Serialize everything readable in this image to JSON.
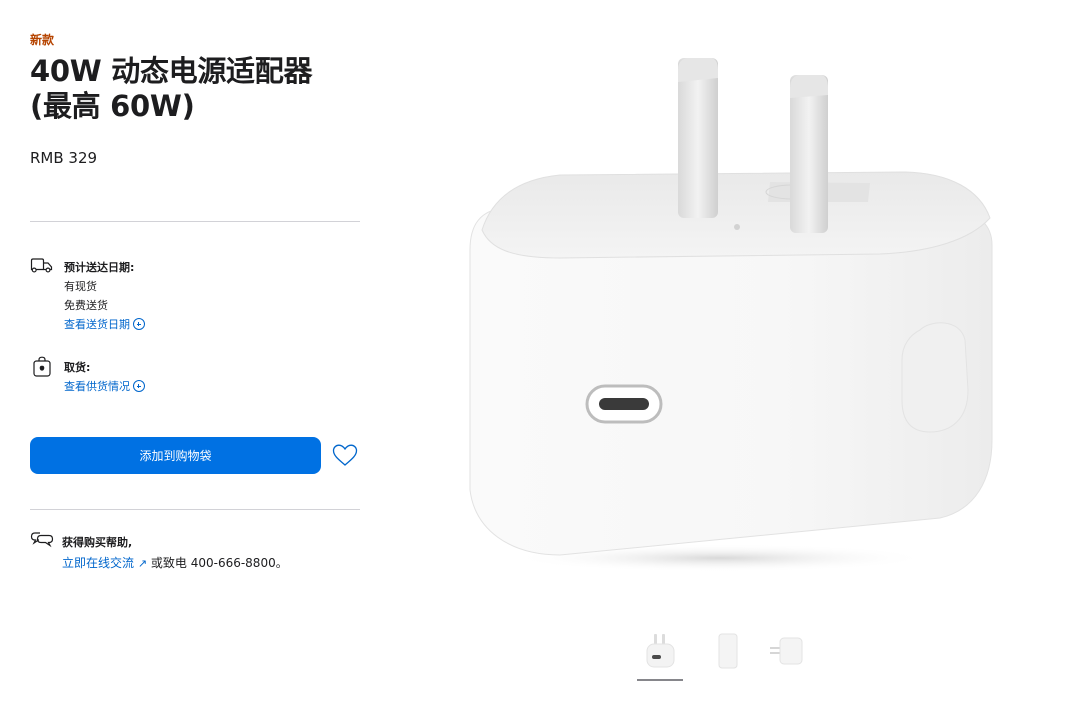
{
  "product": {
    "badge": "新款",
    "title_line1": "40W 动态电源适配器",
    "title_line2": "(最高 60W)",
    "price": "RMB 329"
  },
  "delivery": {
    "heading": "预计送达日期:",
    "stock": "有现货",
    "shipping": "免费送货",
    "link": "查看送货日期"
  },
  "pickup": {
    "heading": "取货:",
    "link": "查看供货情况"
  },
  "actions": {
    "add_to_bag": "添加到购物袋"
  },
  "help": {
    "heading": "获得购买帮助,",
    "chat_link": "立即在线交流",
    "arrow": "↗",
    "phone_text": "或致电 400-666-8800。"
  },
  "colors": {
    "accent": "#0071e3",
    "link": "#0066cc",
    "badge": "#b64400"
  },
  "icons": {
    "delivery": "truck-icon",
    "pickup": "bag-icon",
    "favorite": "heart-icon",
    "help": "chat-bubbles-icon",
    "more": "plus-circle-icon"
  }
}
